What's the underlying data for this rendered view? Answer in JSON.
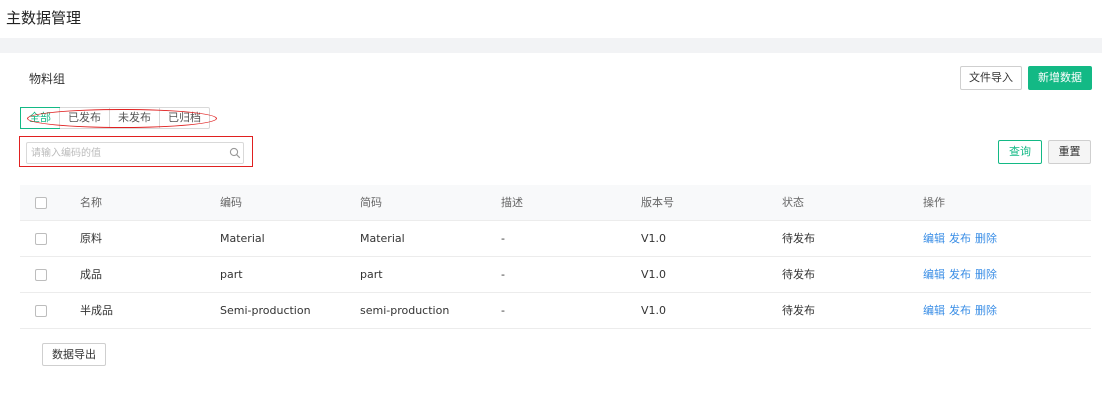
{
  "header": {
    "title": "主数据管理"
  },
  "section": {
    "title": "物料组"
  },
  "toolbar": {
    "import_label": "文件导入",
    "new_label": "新增数据"
  },
  "tabs": [
    {
      "label": "全部"
    },
    {
      "label": "已发布"
    },
    {
      "label": "未发布"
    },
    {
      "label": "已归档"
    }
  ],
  "search": {
    "placeholder": "请输入编码的值",
    "value": ""
  },
  "filters": {
    "query_label": "查询",
    "reset_label": "重置"
  },
  "table": {
    "columns": [
      "名称",
      "编码",
      "简码",
      "描述",
      "版本号",
      "状态",
      "操作"
    ],
    "rows": [
      {
        "name": "原料",
        "code": "Material",
        "short": "Material",
        "desc": "-",
        "version": "V1.0",
        "status": "待发布",
        "ops": [
          "编辑",
          "发布",
          "删除"
        ]
      },
      {
        "name": "成品",
        "code": "part",
        "short": "part",
        "desc": "-",
        "version": "V1.0",
        "status": "待发布",
        "ops": [
          "编辑",
          "发布",
          "删除"
        ]
      },
      {
        "name": "半成品",
        "code": "Semi-production",
        "short": "semi-production",
        "desc": "-",
        "version": "V1.0",
        "status": "待发布",
        "ops": [
          "编辑",
          "发布",
          "删除"
        ]
      }
    ]
  },
  "footer": {
    "export_label": "数据导出"
  },
  "colors": {
    "accent": "#13b985",
    "link": "#3a8ee6",
    "annotation": "#e02020"
  }
}
